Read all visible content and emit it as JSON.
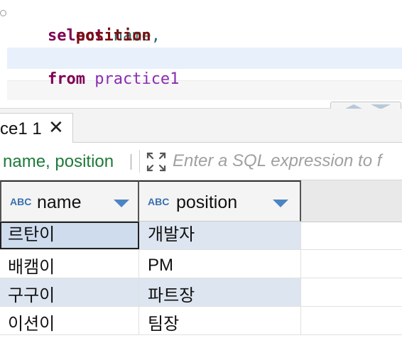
{
  "editor": {
    "lines": [
      {
        "keyword": "select",
        "text": "name,"
      },
      {
        "text": "position"
      },
      {
        "keyword": "from",
        "text": "practice1"
      }
    ]
  },
  "results_tab": {
    "label": "ce1 1",
    "close_icon": "close-icon"
  },
  "filter": {
    "order_by": "name, position",
    "placeholder": "Enter a SQL expression to f"
  },
  "grid": {
    "columns": [
      {
        "type_badge": "ABC",
        "label": "name"
      },
      {
        "type_badge": "ABC",
        "label": "position"
      }
    ],
    "rows": [
      {
        "name": "르탄이",
        "position": "개발자"
      },
      {
        "name": "배캠이",
        "position": "PM"
      },
      {
        "name": "구구이",
        "position": "파트장"
      },
      {
        "name": "이션이",
        "position": "팀장"
      }
    ]
  },
  "colors": {
    "keyword": "#7f0055",
    "table_name": "#8a2cb0",
    "order_text": "#1e7a3a",
    "row_highlight": "#dde5f0",
    "type_badge": "#3a6fb0"
  }
}
